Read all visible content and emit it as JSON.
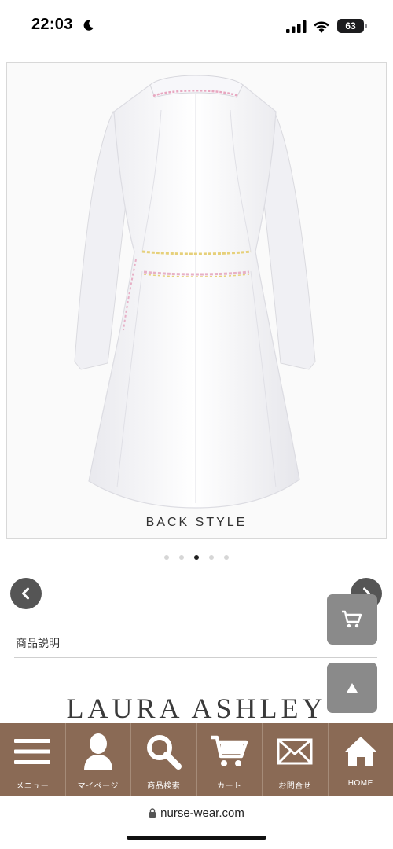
{
  "status_bar": {
    "time": "22:03",
    "battery": "63"
  },
  "product": {
    "image_caption": "BACK STYLE",
    "carousel": {
      "total": 5,
      "active_index": 2
    }
  },
  "description": {
    "section_title": "商品説明",
    "brand_logo": "LAURA ASHLEY"
  },
  "bottom_nav": {
    "items": [
      {
        "label": "メニュー",
        "icon": "menu-icon"
      },
      {
        "label": "マイページ",
        "icon": "user-icon"
      },
      {
        "label": "商品検索",
        "icon": "search-icon"
      },
      {
        "label": "カート",
        "icon": "cart-icon"
      },
      {
        "label": "お問合せ",
        "icon": "mail-icon"
      },
      {
        "label": "HOME",
        "icon": "home-icon"
      }
    ]
  },
  "browser": {
    "url": "nurse-wear.com"
  },
  "colors": {
    "nav_background": "#8a6a55",
    "float_button": "#8a8a8a",
    "arrow_button": "#555555"
  }
}
